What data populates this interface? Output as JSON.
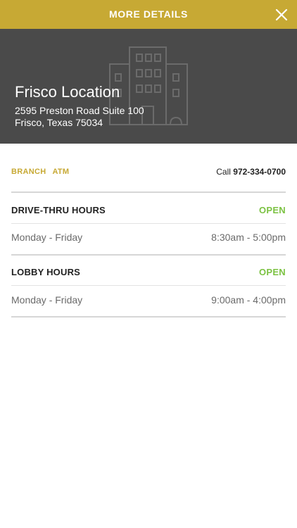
{
  "header": {
    "title": "MORE DETAILS",
    "close_icon": "close-icon"
  },
  "location": {
    "name": "Frisco Location",
    "address_line1": "2595 Preston Road Suite 100",
    "address_line2": "Frisco, Texas 75034",
    "hero_icon": "building-icon"
  },
  "info": {
    "tags": [
      "BRANCH",
      "ATM"
    ],
    "call_label": "Call",
    "phone": "972-334-0700"
  },
  "sections": [
    {
      "title": "DRIVE-THRU HOURS",
      "status": "OPEN",
      "rows": [
        {
          "days": "Monday - Friday",
          "hours": "8:30am - 5:00pm"
        }
      ]
    },
    {
      "title": "LOBBY HOURS",
      "status": "OPEN",
      "rows": [
        {
          "days": "Monday - Friday",
          "hours": "9:00am - 4:00pm"
        }
      ]
    }
  ],
  "colors": {
    "header_bg": "#c7a934",
    "hero_bg": "#4a4a4a",
    "accent_gold": "#c7a934",
    "open_green": "#7cc243"
  }
}
